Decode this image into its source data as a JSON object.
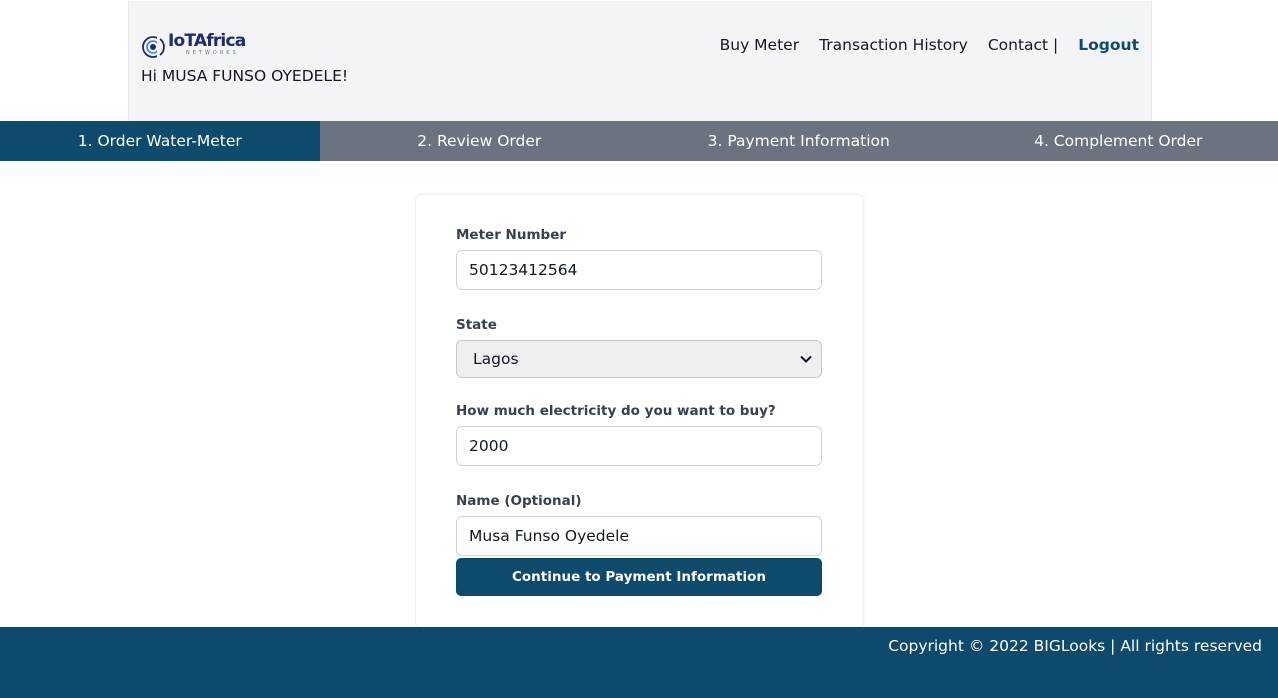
{
  "header": {
    "logo": {
      "brand_iot": "IoT",
      "brand_africa": "Africa",
      "brand_sub": "NETWORKS"
    },
    "greeting": "Hi MUSA FUNSO OYEDELE!",
    "nav": {
      "buy_meter": "Buy Meter",
      "transaction_history": "Transaction History",
      "contact": "Contact |",
      "logout": "Logout"
    }
  },
  "steps": [
    {
      "label": "1. Order Water-Meter",
      "active": true
    },
    {
      "label": "2. Review Order",
      "active": false
    },
    {
      "label": "3. Payment Information",
      "active": false
    },
    {
      "label": "4. Complement Order",
      "active": false
    }
  ],
  "form": {
    "meter_number": {
      "label": "Meter Number",
      "value": "50123412564"
    },
    "state": {
      "label": "State",
      "value": "Lagos"
    },
    "amount": {
      "label": "How much electricity do you want to buy?",
      "value": "2000"
    },
    "name": {
      "label": "Name (Optional)",
      "value": "Musa Funso Oyedele"
    },
    "submit_label": "Continue to Payment Information"
  },
  "footer": {
    "copyright": "Copyright © 2022 BIGLooks | All rights reserved"
  },
  "colors": {
    "primary": "#0d4a6b",
    "step_inactive": "#6b7280",
    "header_bg": "#f3f4f6",
    "logo_blue": "#1e2c6f"
  },
  "icons": {
    "logo": "iot-africa-logo-icon",
    "select_arrow": "chevron-down-icon"
  }
}
